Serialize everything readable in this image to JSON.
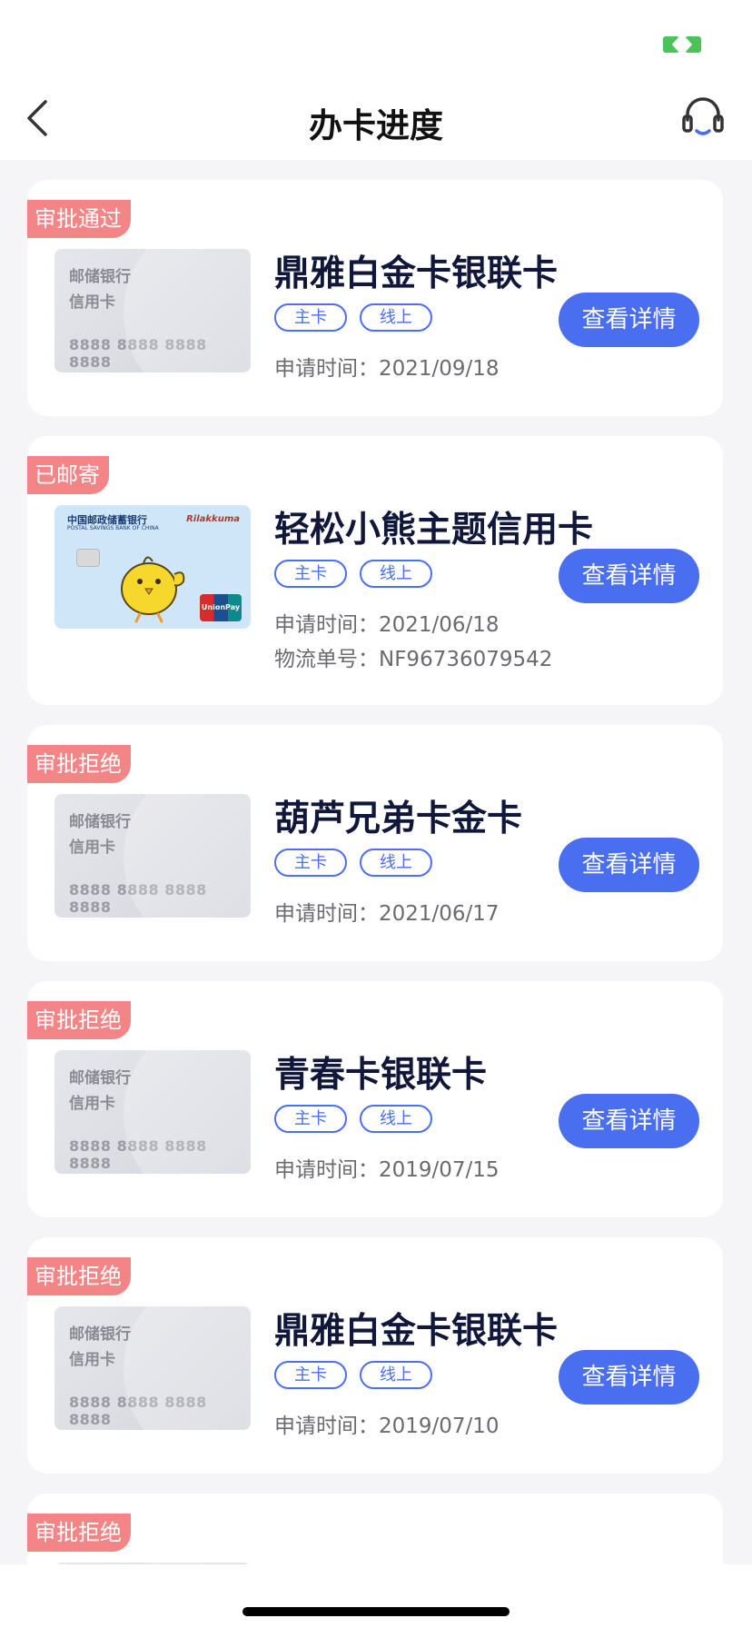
{
  "header": {
    "title": "办卡进度",
    "back_icon": "chevron-left-icon",
    "support_icon": "headset-icon"
  },
  "colors": {
    "accent": "#4a6ef0",
    "badge": "#f48587",
    "title": "#10173a",
    "background": "#f5f5f7"
  },
  "labels": {
    "detail_button": "查看详情",
    "apply_time_prefix": "申请时间：",
    "tracking_prefix": "物流单号："
  },
  "applications": [
    {
      "status": "审批通过",
      "card_name": "鼎雅白金卡银联卡",
      "tags": [
        "主卡",
        "线上"
      ],
      "apply_date": "2021/09/18",
      "tracking_no": null,
      "card_face": {
        "bank": "邮储银行",
        "subtitle": "信用卡",
        "number": "8888 8888 8888 8888"
      }
    },
    {
      "status": "已邮寄",
      "card_name": "轻松小熊主题信用卡",
      "tags": [
        "主卡",
        "线上"
      ],
      "apply_date": "2021/06/18",
      "tracking_no": "NF96736079542",
      "card_art": {
        "bank": "中国邮政储蓄银行",
        "brand": "Rilakkuma",
        "subtitle": "POSTAL SAVINGS BANK OF CHINA",
        "network": "UnionPay 银联"
      }
    },
    {
      "status": "审批拒绝",
      "card_name": "葫芦兄弟卡金卡",
      "tags": [
        "主卡",
        "线上"
      ],
      "apply_date": "2021/06/17",
      "tracking_no": null,
      "card_face": {
        "bank": "邮储银行",
        "subtitle": "信用卡",
        "number": "8888 8888 8888 8888"
      }
    },
    {
      "status": "审批拒绝",
      "card_name": "青春卡银联卡",
      "tags": [
        "主卡",
        "线上"
      ],
      "apply_date": "2019/07/15",
      "tracking_no": null,
      "card_face": {
        "bank": "邮储银行",
        "subtitle": "信用卡",
        "number": "8888 8888 8888 8888"
      }
    },
    {
      "status": "审批拒绝",
      "card_name": "鼎雅白金卡银联卡",
      "tags": [
        "主卡",
        "线上"
      ],
      "apply_date": "2019/07/10",
      "tracking_no": null,
      "card_face": {
        "bank": "邮储银行",
        "subtitle": "信用卡",
        "number": "8888 8888 8888 8888"
      }
    },
    {
      "status": "审批拒绝"
    }
  ]
}
